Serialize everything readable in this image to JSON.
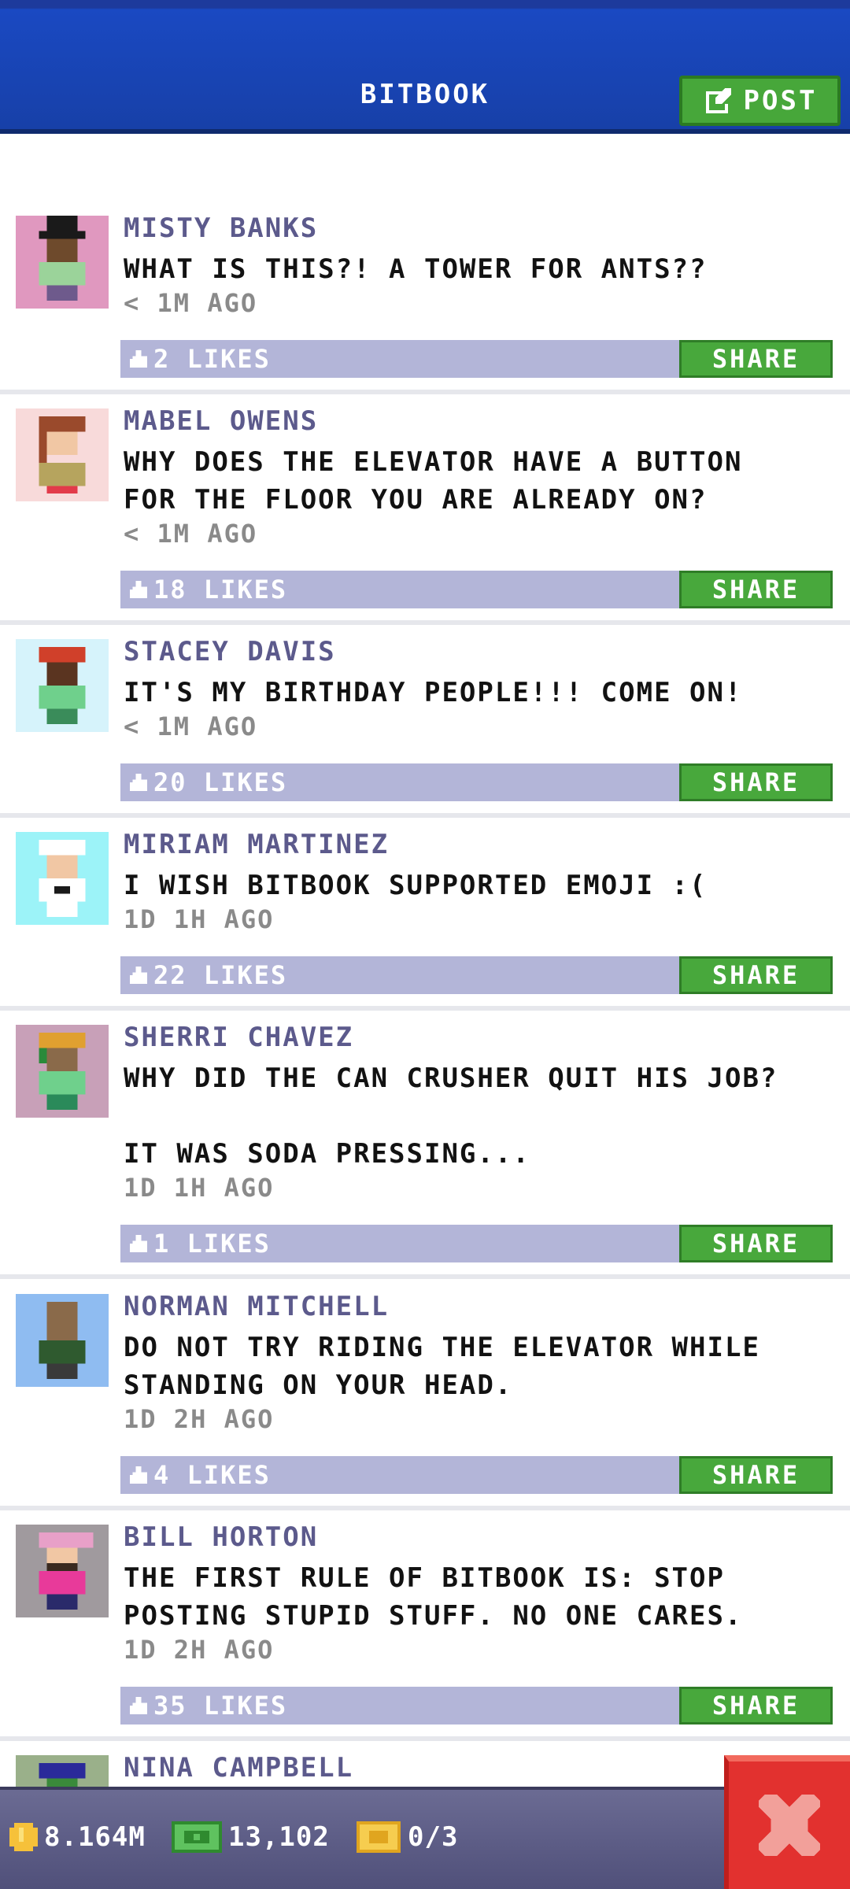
{
  "header": {
    "title": "BITBOOK",
    "post_label": "POST"
  },
  "share_label": "SHARE",
  "posts": [
    {
      "name": "MISTY BANKS",
      "message": "WHAT IS THIS?! A TOWER FOR ANTS??",
      "time": "< 1M AGO",
      "likes": "2 LIKES"
    },
    {
      "name": "MABEL OWENS",
      "message": "WHY DOES THE ELEVATOR HAVE A BUTTON\nFOR THE FLOOR YOU ARE ALREADY ON?",
      "time": "< 1M AGO",
      "likes": "18 LIKES"
    },
    {
      "name": "STACEY DAVIS",
      "message": "IT'S MY BIRTHDAY PEOPLE!!! COME ON!",
      "time": "< 1M AGO",
      "likes": "20 LIKES"
    },
    {
      "name": "MIRIAM MARTINEZ",
      "message": "I WISH BITBOOK SUPPORTED EMOJI :(",
      "time": "1D 1H AGO",
      "likes": "22 LIKES"
    },
    {
      "name": "SHERRI CHAVEZ",
      "message": "WHY DID THE CAN CRUSHER QUIT HIS JOB?\n\nIT WAS SODA PRESSING...",
      "time": "1D 1H AGO",
      "likes": "1 LIKES"
    },
    {
      "name": "NORMAN MITCHELL",
      "message": "DO NOT TRY RIDING THE ELEVATOR WHILE\nSTANDING ON YOUR HEAD.",
      "time": "1D 2H AGO",
      "likes": "4 LIKES"
    },
    {
      "name": "BILL HORTON",
      "message": "THE FIRST RULE OF BITBOOK IS: STOP\nPOSTING STUPID STUFF. NO ONE CARES.",
      "time": "1D 2H AGO",
      "likes": "35 LIKES"
    },
    {
      "name": "NINA CAMPBELL",
      "message": "",
      "time": "",
      "likes": ""
    }
  ],
  "status": {
    "coins": "8.164M",
    "bux": "13,102",
    "tickets": "0/3"
  },
  "colors": {
    "header": "#1a49c2",
    "share": "#48a83c",
    "like_bar": "#b3b5d8",
    "name": "#5c5a8c",
    "close": "#e2312f"
  },
  "icons": {
    "post": "edit-icon",
    "like": "thumbs-up-icon",
    "coin": "coin-icon",
    "bux": "bux-icon",
    "ticket": "ticket-icon",
    "close": "close-icon"
  }
}
